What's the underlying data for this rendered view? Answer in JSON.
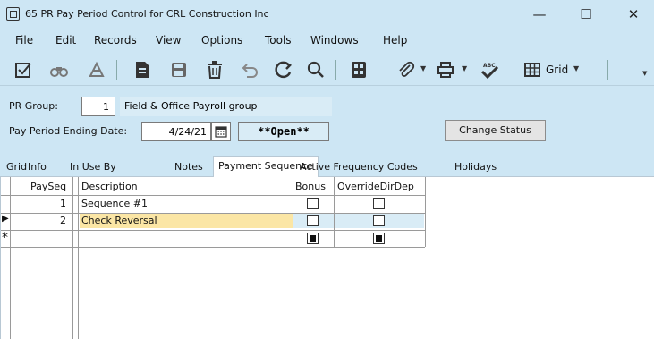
{
  "window": {
    "title": "65 PR Pay Period Control for CRL Construction Inc",
    "minimize": "—",
    "maximize": "☐",
    "close": "✕"
  },
  "menu": [
    "File",
    "Edit",
    "Records",
    "View",
    "Options",
    "Tools",
    "Windows",
    "Help"
  ],
  "toolbar": {
    "icons": [
      "checkbox-icon",
      "binoculars-icon",
      "lookup-icon",
      "report-icon",
      "save-icon",
      "delete-icon",
      "undo-icon",
      "refresh-icon",
      "search-icon",
      "calculator-icon",
      "attachment-icon",
      "print-icon",
      "spellcheck-icon",
      "grid-icon"
    ],
    "grid_label": "Grid"
  },
  "header": {
    "pr_group_label": "PR Group:",
    "pr_group_value": "1",
    "pr_group_name": "Field & Office Payroll group",
    "pay_period_label": "Pay Period Ending Date:",
    "pay_period_value": "4/24/21",
    "status": "**Open**",
    "change_status_label": "Change Status"
  },
  "tabs": [
    "Grid",
    "Info",
    "In Use By",
    "Notes",
    "Payment Sequence",
    "Active Frequency Codes",
    "Holidays"
  ],
  "active_tab": "Payment Sequence",
  "grid": {
    "columns": [
      "PaySeq",
      "Description",
      "Bonus",
      "OverrideDirDep"
    ],
    "rows": [
      {
        "payseq": "1",
        "description": "Sequence #1",
        "bonus": false,
        "override": false
      },
      {
        "payseq": "2",
        "description": "Check Reversal",
        "bonus": false,
        "override": false
      }
    ],
    "new_row_marker": "*",
    "current_row_marker": "▶"
  },
  "colors": {
    "panel_bg": "#cde6f4",
    "highlight": "#fbe6a5"
  }
}
